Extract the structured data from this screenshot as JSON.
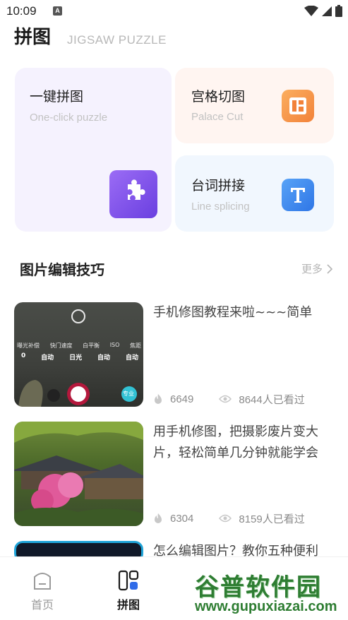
{
  "status_bar": {
    "time": "10:09",
    "a_icon": "A"
  },
  "header": {
    "title": "拼图",
    "subtitle": "JIGSAW PUZZLE"
  },
  "feature_cards": {
    "oneclick": {
      "title": "一键拼图",
      "subtitle": "One-click puzzle",
      "icon": "puzzle-icon",
      "color": "#7b4fe8"
    },
    "palace": {
      "title": "宫格切图",
      "subtitle": "Palace Cut",
      "icon": "grid-layout-icon",
      "color": "#f5913e"
    },
    "line": {
      "title": "台词拼接",
      "subtitle": "Line splicing",
      "icon": "text-t-icon",
      "color": "#3a86ef"
    }
  },
  "section": {
    "title": "图片编辑技巧",
    "more": "更多"
  },
  "articles": [
    {
      "title": "手机修图教程来啦~~~简单",
      "likes": "6649",
      "views": "8644人已看过",
      "thumb": [
        "曝光补偿",
        "快门速度",
        "白平衡",
        "ISO",
        "焦距"
      ],
      "thumb_values": [
        "0",
        "自动",
        "日光",
        "自动",
        "自动"
      ],
      "thumb_badge": "专业"
    },
    {
      "title": "用手机修图，把摄影废片变大片，轻松简单几分钟就能学会",
      "likes": "6304",
      "views": "8159人已看过"
    },
    {
      "title": "怎么编辑图片？教你五种便利"
    }
  ],
  "tabbar": {
    "home": "首页",
    "puzzle": "拼图",
    "accent": "#1a1a1a",
    "inactive": "#9a9a9a"
  },
  "watermark": {
    "title": "谷普软件园",
    "url": "www.gupuxiazai.com"
  }
}
